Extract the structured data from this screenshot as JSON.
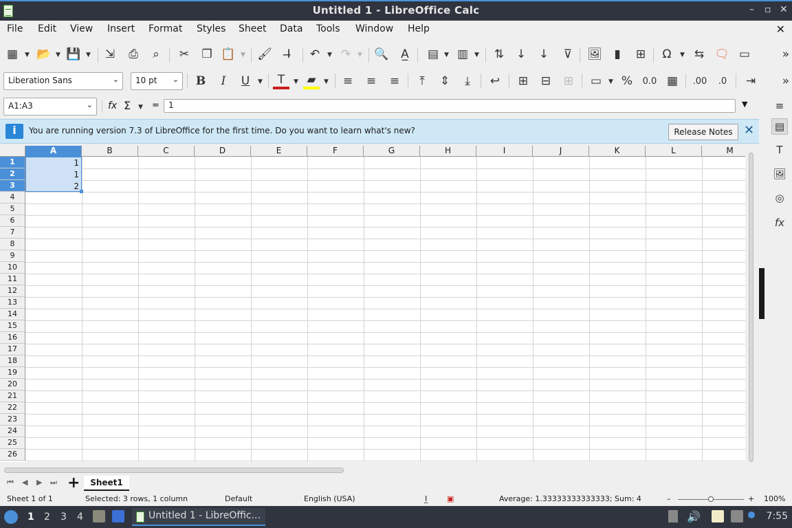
{
  "window": {
    "title": "Untitled 1 - LibreOffice Calc",
    "controls": [
      "–",
      "▫",
      "✕"
    ]
  },
  "menu": [
    "File",
    "Edit",
    "View",
    "Insert",
    "Format",
    "Styles",
    "Sheet",
    "Data",
    "Tools",
    "Window",
    "Help"
  ],
  "formatting": {
    "font_name": "Liberation Sans",
    "font_size": "10 pt",
    "bold": "B",
    "italic": "I",
    "underline": "U",
    "percent": "%",
    "decimal": "0.0"
  },
  "formula_bar": {
    "name_box": "A1:A3",
    "fx": "fx",
    "sigma": "Σ",
    "equals": "=",
    "content": "1"
  },
  "infobar": {
    "message": "You are running version 7.3 of LibreOffice for the first time. Do you want to learn what's new?",
    "button": "Release Notes",
    "icon": "i"
  },
  "grid": {
    "columns": [
      "A",
      "B",
      "C",
      "D",
      "E",
      "F",
      "G",
      "H",
      "I",
      "J",
      "K",
      "L",
      "M"
    ],
    "rows": [
      "1",
      "2",
      "3",
      "4",
      "5",
      "6",
      "7",
      "8",
      "9",
      "10",
      "11",
      "12",
      "13",
      "14",
      "15",
      "16",
      "17",
      "18",
      "19",
      "20",
      "21",
      "22",
      "23",
      "24",
      "25",
      "26"
    ],
    "cells": {
      "A1": "1",
      "A2": "1",
      "A3": "2"
    }
  },
  "sheet_tabs": {
    "add": "+",
    "active": "Sheet1"
  },
  "status": {
    "sheet": "Sheet 1 of 1",
    "selection": "Selected: 3 rows, 1 column",
    "style": "Default",
    "language": "English (USA)",
    "stats": "Average: 1.33333333333333; Sum: 4",
    "zoom_minus": "–",
    "zoom_plus": "+",
    "zoom": "100%",
    "zoom_level": 0.5
  },
  "taskbar": {
    "workspaces": [
      "1",
      "2",
      "3",
      "4"
    ],
    "task_label": "Untitled 1 - LibreOffic...",
    "clock": "7:55"
  },
  "colors": {
    "accent": "#4a90d9",
    "selection_fill": "#cfe2f5",
    "titlebar": "#2f343f",
    "infobar": "#cfe8f6"
  }
}
